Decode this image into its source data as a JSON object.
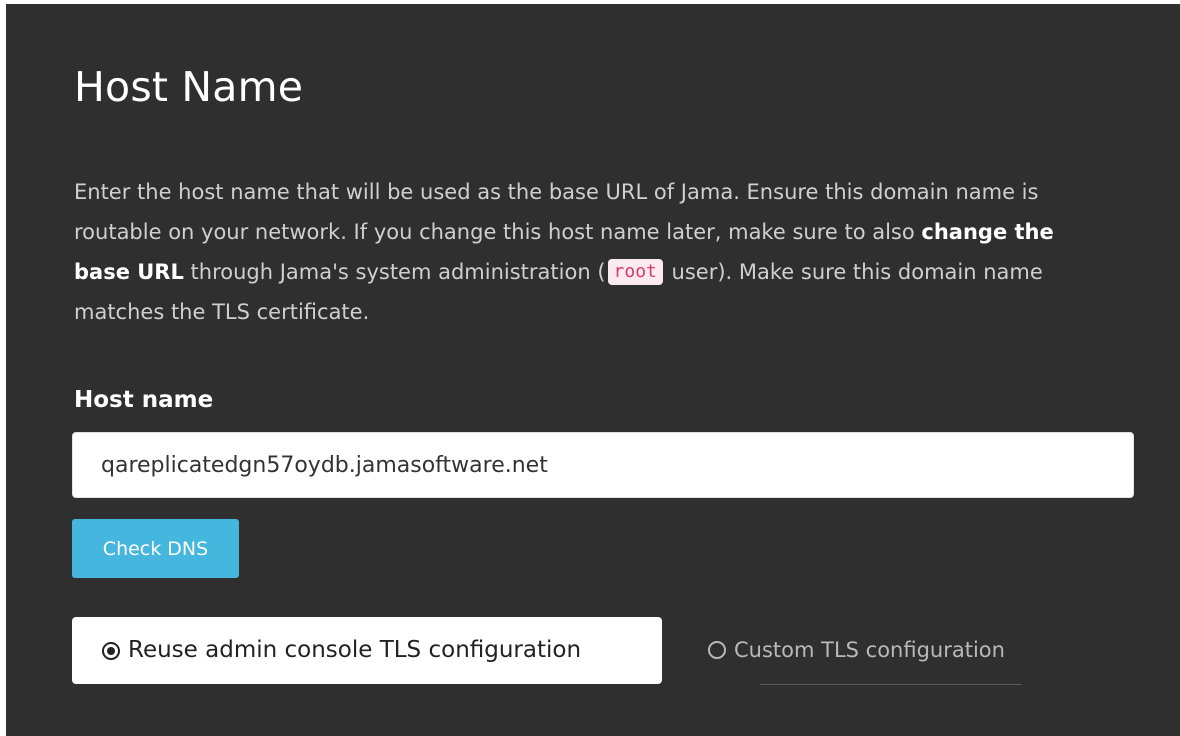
{
  "section": {
    "title": "Host Name",
    "description": {
      "part1": "Enter the host name that will be used as the base URL of Jama. Ensure this domain name is routable on your network. If you change this host name later, make sure to also ",
      "bold": "change the base URL",
      "part2": " through Jama's system administration (",
      "code": "root",
      "part3": " user). Make sure this domain name matches the TLS certificate."
    }
  },
  "form": {
    "host_label": "Host name",
    "host_value": "qareplicatedgn57oydb.jamasoftware.net",
    "check_dns_label": "Check DNS",
    "tls_options": [
      {
        "label": "Reuse admin console TLS configuration",
        "selected": true
      },
      {
        "label": "Custom TLS configuration",
        "selected": false
      }
    ]
  },
  "colors": {
    "background": "#2f2f2f",
    "accent": "#45b6dd",
    "code_text": "#d63a6f"
  },
  "icons": {
    "radio_selected": "radio-checked-icon",
    "radio_unselected": "radio-unchecked-icon"
  }
}
